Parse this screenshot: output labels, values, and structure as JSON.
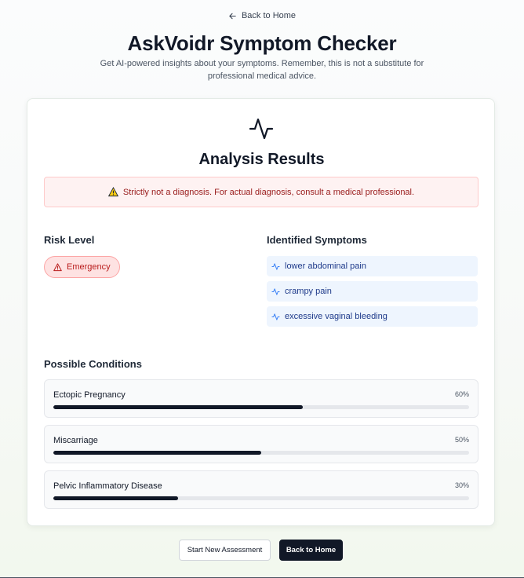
{
  "nav": {
    "back_label": "Back to Home",
    "back_icon": "arrow-left-icon"
  },
  "header": {
    "title": "AskVoidr Symptom Checker",
    "subtitle": "Get AI-powered insights about your symptoms. Remember, this is not a substitute for professional medical advice."
  },
  "results": {
    "icon": "pulse-icon",
    "title": "Analysis Results",
    "warning": "Strictly not a diagnosis. For actual diagnosis, consult a medical professional.",
    "warning_icon": "warning-triangle-icon",
    "risk": {
      "label": "Risk Level",
      "value": "Emergency",
      "color": "#b91c1c"
    },
    "symptoms": {
      "label": "Identified Symptoms",
      "items": [
        "lower abdominal pain",
        "crampy pain",
        "excessive vaginal bleeding"
      ]
    },
    "conditions": {
      "label": "Possible Conditions",
      "items": [
        {
          "name": "Ectopic Pregnancy",
          "percent_label": "60%",
          "value": 0.6
        },
        {
          "name": "Miscarriage",
          "percent_label": "50%",
          "value": 0.5
        },
        {
          "name": "Pelvic Inflammatory Disease",
          "percent_label": "30%",
          "value": 0.3
        }
      ]
    }
  },
  "actions": {
    "new_assessment": "Start New Assessment",
    "back_home": "Back to Home"
  },
  "colors": {
    "primary": "#111827",
    "danger": "#b91c1c",
    "symptom_bg": "#eef5fe"
  }
}
